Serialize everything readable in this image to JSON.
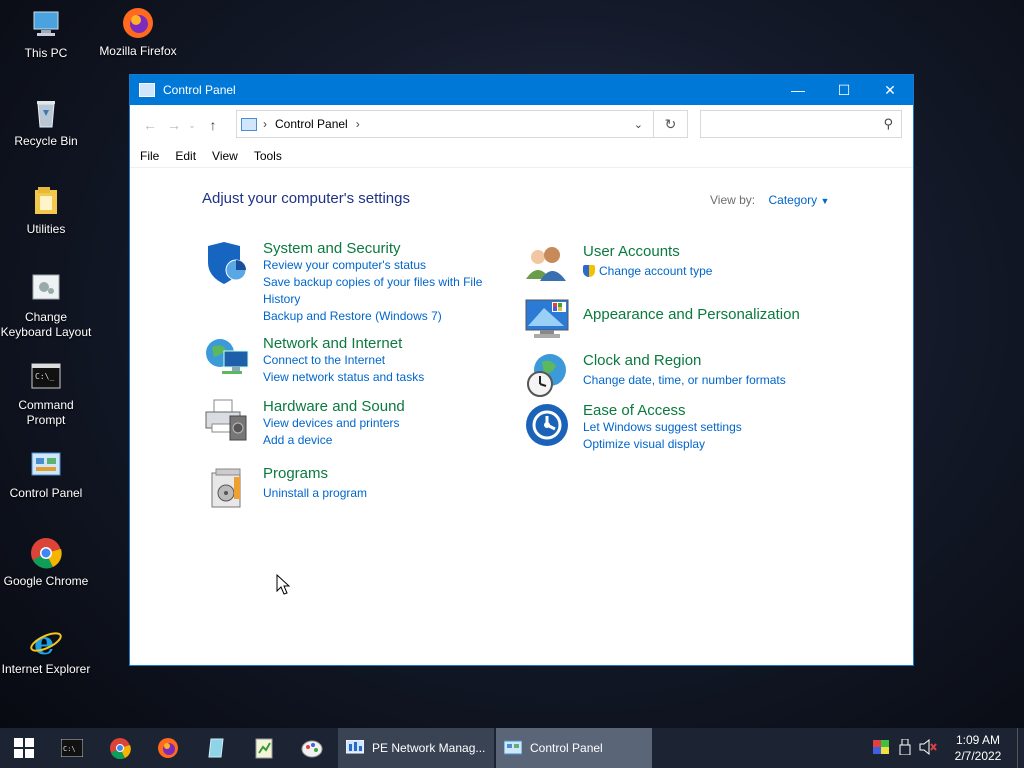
{
  "desktop": {
    "icons": [
      {
        "label": "This PC"
      },
      {
        "label": "Mozilla Firefox"
      },
      {
        "label": "Recycle Bin"
      },
      {
        "label": "Utilities"
      },
      {
        "label": "Change Keyboard Layout"
      },
      {
        "label": "Command Prompt"
      },
      {
        "label": "Control Panel"
      },
      {
        "label": "Google Chrome"
      },
      {
        "label": "Internet Explorer"
      }
    ]
  },
  "window": {
    "title": "Control Panel",
    "address": "Control Panel",
    "search_placeholder": "",
    "menu": [
      "File",
      "Edit",
      "View",
      "Tools"
    ],
    "heading": "Adjust your computer's settings",
    "view_by_label": "View by:",
    "view_by_value": "Category",
    "categories": {
      "system": {
        "title": "System and Security",
        "links": [
          "Review your computer's status",
          "Save backup copies of your files with File",
          "History",
          "Backup and Restore (Windows 7)"
        ]
      },
      "network": {
        "title": "Network and Internet",
        "links": [
          "Connect to the Internet",
          "View network status and tasks"
        ]
      },
      "hardware": {
        "title": "Hardware and Sound",
        "links": [
          "View devices and printers",
          "Add a device"
        ]
      },
      "programs": {
        "title": "Programs",
        "links": [
          "Uninstall a program"
        ]
      },
      "accounts": {
        "title": "User Accounts",
        "links": [
          "Change account type"
        ]
      },
      "appearance": {
        "title": "Appearance and Personalization",
        "links": []
      },
      "clock": {
        "title": "Clock and Region",
        "links": [
          "Change date, time, or number formats"
        ]
      },
      "ease": {
        "title": "Ease of Access",
        "links": [
          "Let Windows suggest settings",
          "Optimize visual display"
        ]
      }
    }
  },
  "taskbar": {
    "apps": [
      {
        "label": "PE Network Manag..."
      },
      {
        "label": "Control Panel"
      }
    ],
    "time": "1:09 AM",
    "date": "2/7/2022"
  },
  "colors": {
    "accent": "#0078d7",
    "link": "#0066cc",
    "category_title": "#0b7a3e",
    "heading": "#1e3287"
  }
}
